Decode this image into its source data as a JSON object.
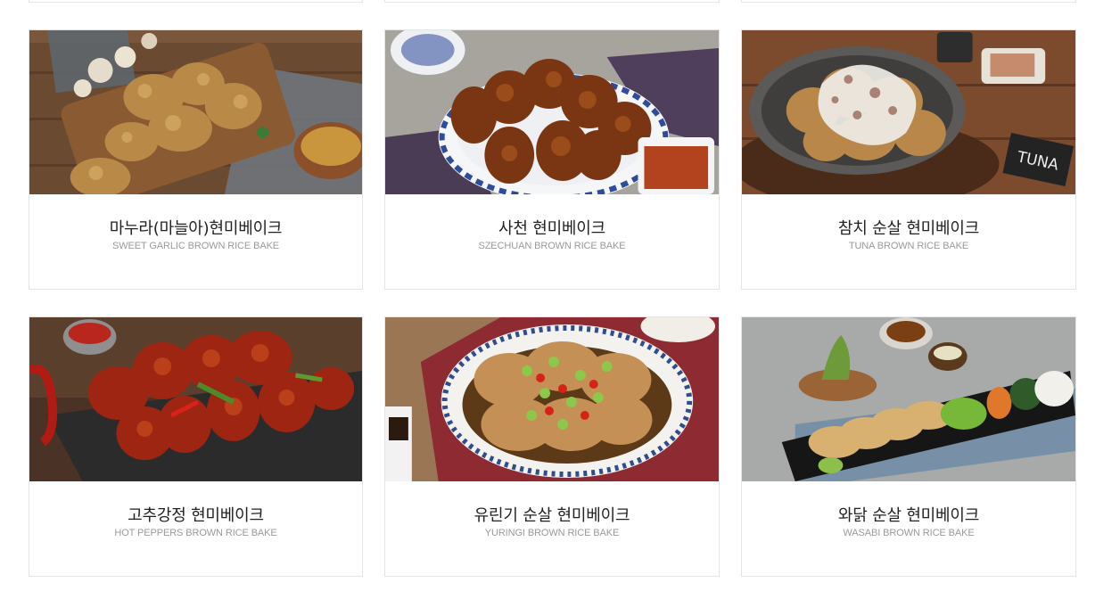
{
  "menu": {
    "items": [
      {
        "name": "마누라(마늘아)현미베이크",
        "subtitle": "SWEET GARLIC BROWN RICE BAKE",
        "image": "sweet-garlic-chicken-photo"
      },
      {
        "name": "사천 현미베이크",
        "subtitle": "SZECHUAN BROWN RICE BAKE",
        "image": "szechuan-chicken-photo"
      },
      {
        "name": "참치 순살 현미베이크",
        "subtitle": "TUNA BROWN RICE BAKE",
        "image": "tuna-chicken-photo"
      },
      {
        "name": "고추강정 현미베이크",
        "subtitle": "HOT PEPPERS BROWN RICE BAKE",
        "image": "hot-peppers-chicken-photo"
      },
      {
        "name": "유린기 순살 현미베이크",
        "subtitle": "YURINGI BROWN RICE BAKE",
        "image": "yuringi-chicken-photo"
      },
      {
        "name": "와닭 순살 현미베이크",
        "subtitle": "WASABI BROWN RICE BAKE",
        "image": "wasabi-chicken-photo"
      }
    ],
    "photo_text": {
      "tuna_sign": "TUNA"
    }
  },
  "colors": {
    "card_border": "#e4e4e4",
    "title": "#222222",
    "subtitle": "#9a9a9a"
  }
}
